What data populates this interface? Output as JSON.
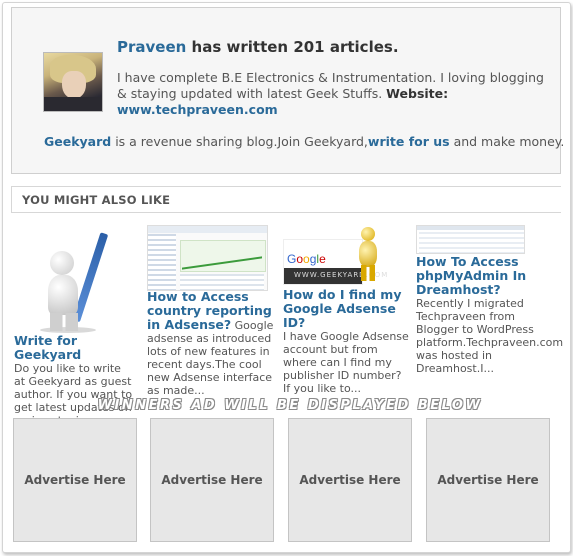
{
  "author": {
    "name": "Praveen",
    "title_suffix": " has written 201 articles.",
    "bio": "I have complete B.E Electronics & Instrumentation. I loving blogging & staying updated with latest Geek Stuffs. ",
    "website_label": "Website:",
    "website": "www.techpraveen.com"
  },
  "revenue": {
    "site": "Geekyard",
    "text1": " is a revenue sharing blog.Join Geekyard,",
    "cta": "write for us",
    "text2": " and make money."
  },
  "related": {
    "header": "YOU MIGHT ALSO LIKE",
    "posts": [
      {
        "title": "Write for Geekyard",
        "excerpt": "Do you like to write at Geekyard as guest author. If you want to get latest updates on various topics...",
        "thumb_icon": "pen-figure-icon"
      },
      {
        "title": "How to Access country reporting in Adsense?",
        "excerpt": " Google adsense as introduced lots of new features in recent days.The cool new Adsense interface as made...",
        "thumb_icon": "analytics-screenshot-icon"
      },
      {
        "title": "How do I find my Google Adsense ID?",
        "excerpt": "I have Google Adsense account but from where can I find my publisher ID number? If you like to...",
        "thumb_icon": "adsense-figure-icon"
      },
      {
        "title": "How To Access phpMyAdmin In Dreamhost?",
        "excerpt": " Recently I migrated Techpraveen from Blogger to WordPress platform.Techpraveen.com was hosted in Dreamhost.I...",
        "thumb_icon": "table-screenshot-icon"
      }
    ],
    "adsense_logo_text": "Google AdSense",
    "adsense_footer": "WWW.GEEKYARD.COM"
  },
  "ads": {
    "banner": "WINNERS AD WILL BE DISPLAYED BELOW",
    "slots": [
      "Advertise Here",
      "Advertise Here",
      "Advertise Here",
      "Advertise Here"
    ]
  },
  "colors": {
    "link": "#2a6a99",
    "box_bg": "#f6f6f6",
    "ad_bg": "#e7e7e7"
  }
}
